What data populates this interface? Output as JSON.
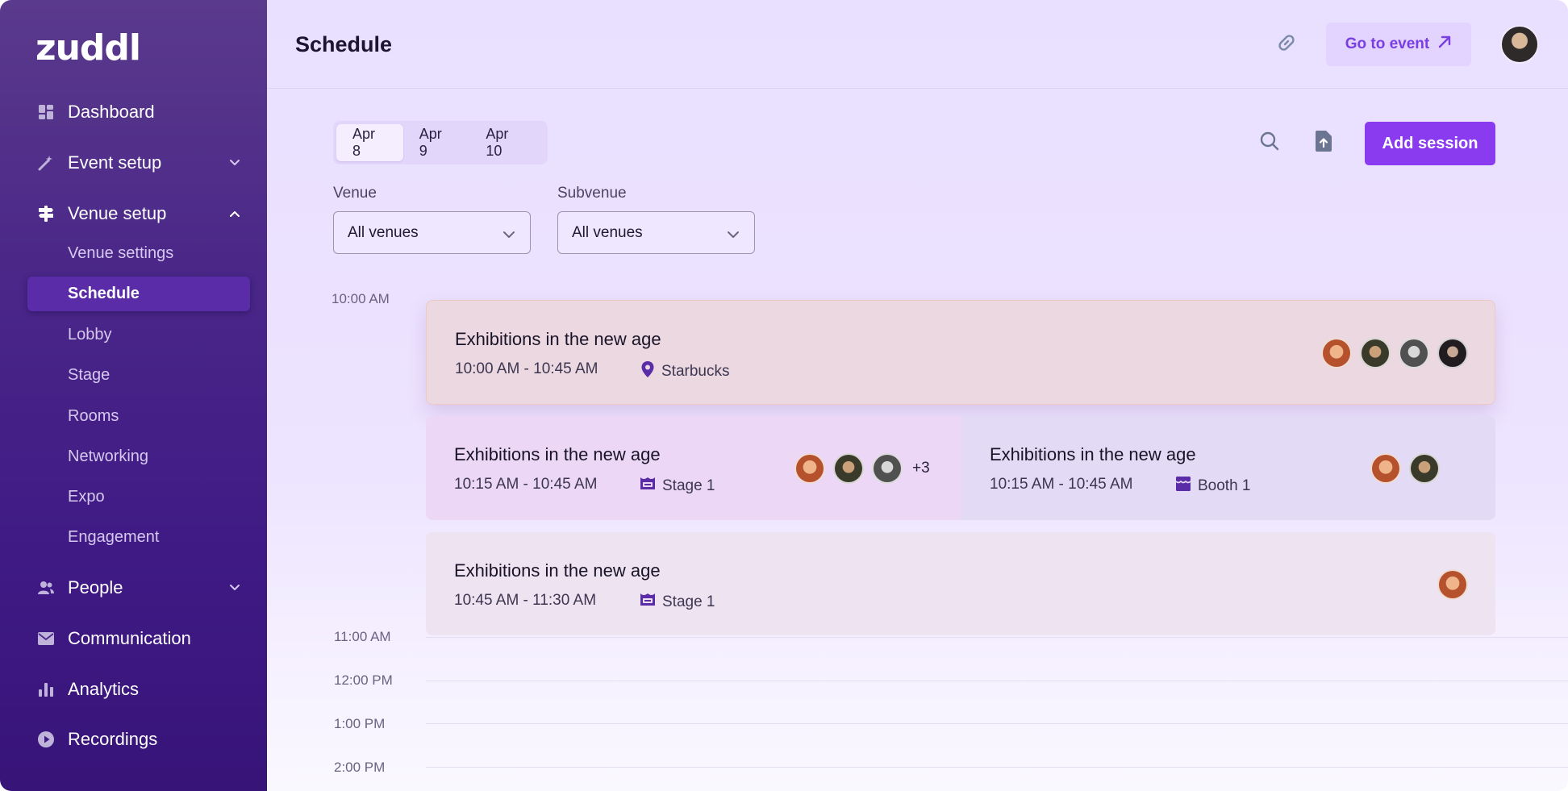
{
  "sidebar": {
    "logo": "zuddl",
    "items": [
      {
        "label": "Dashboard"
      },
      {
        "label": "Event setup"
      },
      {
        "label": "Venue setup"
      },
      {
        "label": "People"
      },
      {
        "label": "Communication"
      },
      {
        "label": "Analytics"
      },
      {
        "label": "Recordings"
      }
    ],
    "venue_sub": [
      {
        "label": "Venue settings"
      },
      {
        "label": "Schedule"
      },
      {
        "label": "Lobby"
      },
      {
        "label": "Stage"
      },
      {
        "label": "Rooms"
      },
      {
        "label": "Networking"
      },
      {
        "label": "Expo"
      },
      {
        "label": "Engagement"
      }
    ]
  },
  "header": {
    "title": "Schedule",
    "goto_label": "Go to event"
  },
  "toolbar": {
    "dates": [
      "Apr 8",
      "Apr 9",
      "Apr 10"
    ],
    "selected_date": "Apr 8",
    "add_label": "Add session"
  },
  "filters": {
    "venue_label": "Venue",
    "venue_value": "All venues",
    "subvenue_label": "Subvenue",
    "subvenue_value": "All venues"
  },
  "timeline": {
    "times": [
      "10:00 AM",
      "11:00 AM",
      "12:00 PM",
      "1:00 PM",
      "2:00 PM"
    ]
  },
  "sessions": [
    {
      "title": "Exhibitions in the new age",
      "time": "10:00 AM - 10:45 AM",
      "location": "Starbucks",
      "location_icon": "map-pin-icon",
      "color": "#ebd8e0"
    },
    {
      "title": "Exhibitions in the new age",
      "time": "10:15 AM - 10:45 AM",
      "location": "Stage 1",
      "location_icon": "stage-icon",
      "more": "+3",
      "color": "#ecd7f7"
    },
    {
      "title": "Exhibitions in the new age",
      "time": "10:15 AM - 10:45 AM",
      "location": "Booth 1",
      "location_icon": "booth-icon",
      "color": "#e3daf5"
    },
    {
      "title": "Exhibitions in the new age",
      "time": "10:45 AM - 11:30 AM",
      "location": "Stage 1",
      "location_icon": "stage-icon",
      "color": "#eee3f1"
    }
  ],
  "colors": {
    "accent": "#8a3bf0",
    "sidebar": "#4a2788",
    "active_nav": "#5a2ca8"
  }
}
